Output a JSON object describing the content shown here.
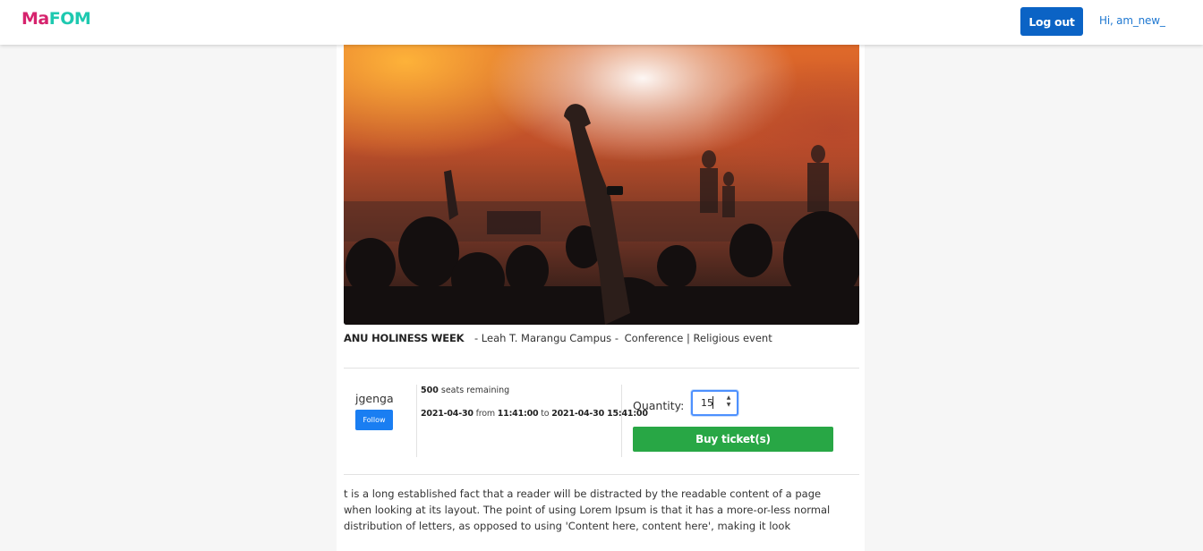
{
  "header": {
    "brand_part1": "Ma",
    "brand_part2": "FOM",
    "logout_label": "Log out",
    "greeting": "Hi, am_new_"
  },
  "event": {
    "title": "ANU HOLINESS WEEK",
    "campus": "- Leah T. Marangu Campus -",
    "type": "Conference | Religious event"
  },
  "organizer": {
    "name": "jgenga",
    "follow_label": "Follow"
  },
  "availability": {
    "seats_count": "500",
    "seats_suffix": "seats remaining"
  },
  "schedule": {
    "start_date": "2021-04-30",
    "from_word": "from",
    "start_time": "11:41:00",
    "to_word": "to",
    "end_datetime": "2021-04-30 15:41:00"
  },
  "purchase": {
    "quantity_label": "Quantity:",
    "quantity_value": "15",
    "buy_label": "Buy ticket(s)"
  },
  "description": {
    "lines": [
      "t is a long established fact that a reader will be distracted by the readable content of a page",
      "when looking at its layout. The point of using Lorem Ipsum is that it has a more-or-less normal",
      "distribution of letters, as opposed to using 'Content here, content here', making it look"
    ]
  },
  "colors": {
    "brand_ma": "#d6236d",
    "brand_fom": "#1ec9b0",
    "logout_bg": "#0b63c5",
    "follow_bg": "#1a7ef2",
    "buy_bg": "#28a745",
    "link": "#1f78d1"
  },
  "icons": {
    "spinner_up": "▲",
    "spinner_down": "▼"
  }
}
